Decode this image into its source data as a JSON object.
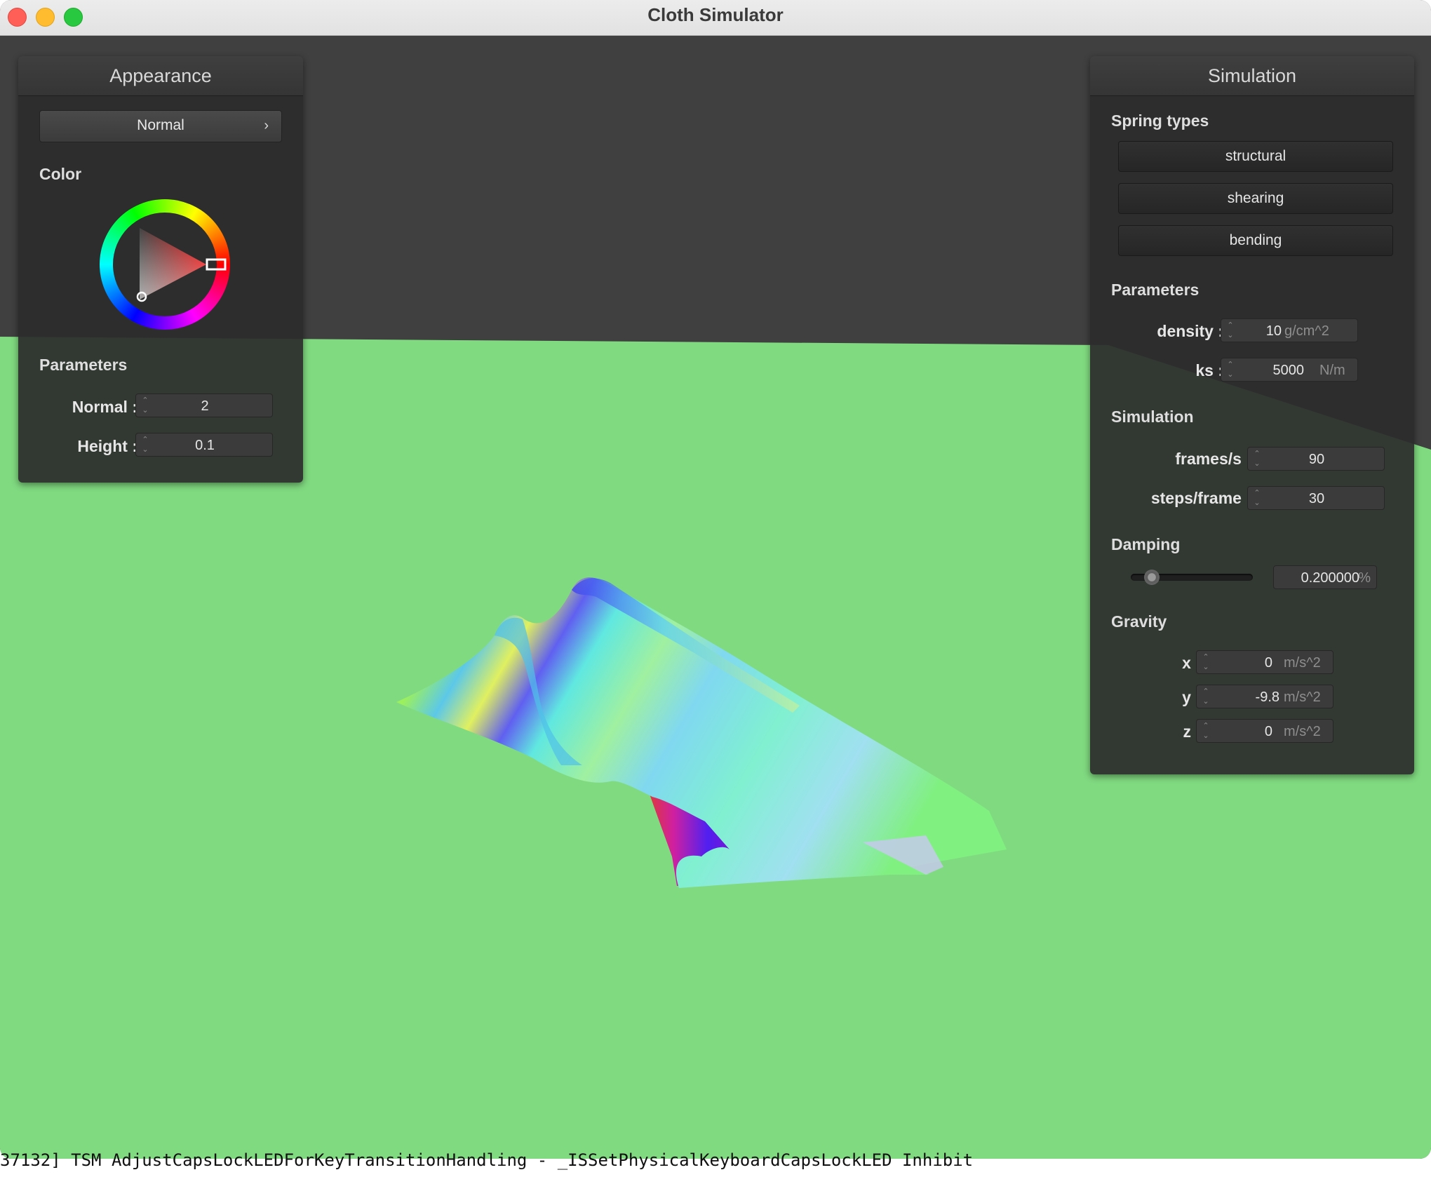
{
  "window": {
    "title": "Cloth Simulator"
  },
  "appearance": {
    "header": "Appearance",
    "shader": "Normal",
    "color_label": "Color",
    "color_value": "#e02020",
    "parameters_label": "Parameters",
    "normal_label": "Normal :",
    "normal_value": "2",
    "height_label": "Height :",
    "height_value": "0.1"
  },
  "simulation": {
    "header": "Simulation",
    "spring_types_label": "Spring types",
    "spring_buttons": [
      "structural",
      "shearing",
      "bending"
    ],
    "parameters_label": "Parameters",
    "density_label": "density :",
    "density_value": "10",
    "density_unit": "g/cm^2",
    "ks_label": "ks :",
    "ks_value": "5000",
    "ks_unit": "N/m",
    "simulation_label": "Simulation",
    "fps_label": "frames/s :",
    "fps_value": "90",
    "steps_label": "steps/frame :",
    "steps_value": "30",
    "damping_label": "Damping",
    "damping_value": "0.200000",
    "damping_unit": "%",
    "damping_fraction": 0.2,
    "gravity_label": "Gravity",
    "gx_label": "x :",
    "gx_value": "0",
    "gy_label": "y :",
    "gy_value": "-9.8",
    "gz_label": "z :",
    "gz_value": "0",
    "gravity_unit": "m/s^2"
  },
  "colors": {
    "background": "#404040",
    "plane": "#80da80",
    "panel": "#2c2c2c"
  },
  "console": {
    "text": "37132] TSM AdjustCapsLockLEDForKeyTransitionHandling - _ISSetPhysicalKeyboardCapsLockLED Inhibit"
  }
}
